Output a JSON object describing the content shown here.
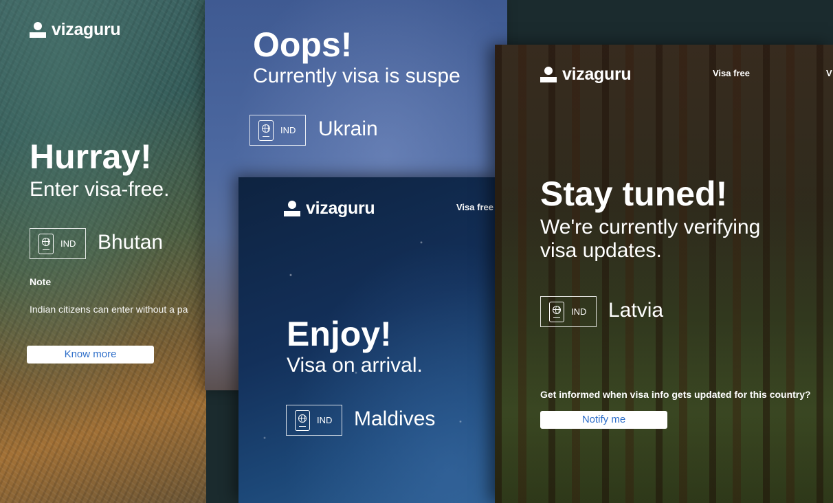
{
  "brand": {
    "name": "vizaguru"
  },
  "cards": {
    "bhutan": {
      "heading": "Hurray!",
      "subheading": "Enter visa-free.",
      "passport_code": "IND",
      "country": "Bhutan",
      "note_label": "Note",
      "note_text": "Indian citizens can enter without a pa",
      "button": "Know more"
    },
    "ukrain": {
      "heading": "Oops!",
      "subheading": "Currently visa is suspe",
      "passport_code": "IND",
      "country": "Ukrain"
    },
    "maldives": {
      "nav_link": "Visa free",
      "heading": "Enjoy!",
      "subheading": "Visa on arrival.",
      "passport_code": "IND",
      "country": "Maldives"
    },
    "latvia": {
      "nav_link": "Visa free",
      "nav_link_2": "V",
      "heading": "Stay tuned!",
      "subheading_line1": "We're currently verifying",
      "subheading_line2": "visa updates.",
      "passport_code": "IND",
      "country": "Latvia",
      "info_text": "Get informed when visa info gets updated for this country?",
      "button": "Notify me"
    }
  },
  "colors": {
    "button_text": "#2f6fc9",
    "button_bg": "#ffffff"
  },
  "icons": {
    "logo": "person-logo-icon",
    "passport": "passport-globe-icon"
  }
}
